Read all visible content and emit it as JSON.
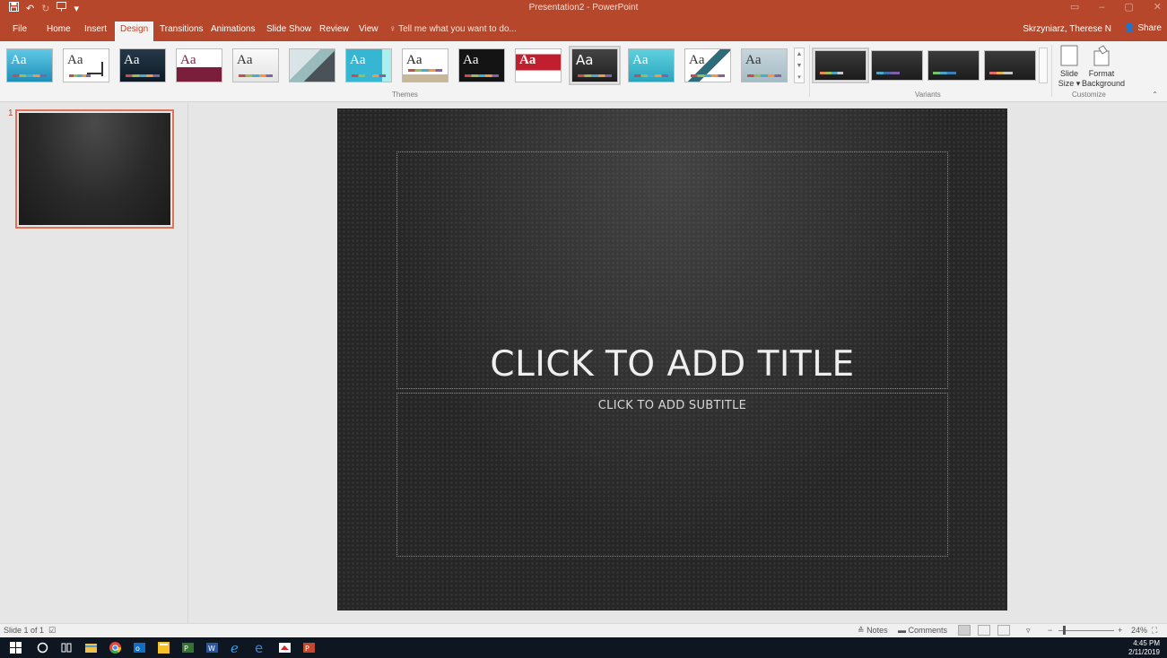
{
  "title_bar": {
    "window_title": "Presentation2 - PowerPoint",
    "qat_icons": [
      "save-icon",
      "undo-icon",
      "redo-icon",
      "start-from-beginning-icon",
      "customize-qat-icon"
    ]
  },
  "tabs": [
    "File",
    "Home",
    "Insert",
    "Design",
    "Transitions",
    "Animations",
    "Slide Show",
    "Review",
    "View"
  ],
  "active_tab": "Design",
  "tell_me": "Tell me what you want to do...",
  "account": {
    "user_name": "Skrzyniarz, Therese N",
    "share_label": "Share"
  },
  "ribbon": {
    "themes_label": "Themes",
    "variants_label": "Variants",
    "customize_label": "Customize",
    "themes": [
      {
        "text": "Aa"
      },
      {
        "text": "Aa"
      },
      {
        "text": "Aa"
      },
      {
        "text": "Aa"
      },
      {
        "text": "Aa"
      },
      {
        "text": ""
      },
      {
        "text": "Aa"
      },
      {
        "text": "Aa"
      },
      {
        "text": "Aa"
      },
      {
        "text": "Aa"
      },
      {
        "text": "Aa"
      },
      {
        "text": "Aa"
      },
      {
        "text": "Aa"
      },
      {
        "text": "Aa"
      }
    ],
    "slide_size": {
      "line1": "Slide",
      "line2": "Size ▾"
    },
    "format_background": {
      "line1": "Format",
      "line2": "Background"
    }
  },
  "thumbnails": {
    "slide_number": "1"
  },
  "slide": {
    "title_placeholder": "CLICK TO ADD TITLE",
    "subtitle_placeholder": "CLICK TO ADD SUBTITLE"
  },
  "status_bar": {
    "slide_info": "Slide 1 of 1",
    "notes": "Notes",
    "comments": "Comments",
    "zoom_minus": "−",
    "zoom_plus": "+",
    "zoom_level": "24%"
  },
  "taskbar": {
    "time": "4:45 PM",
    "date": "2/11/2019"
  },
  "colors": {
    "accent": "#b7472a",
    "slide_bg": "#262626",
    "taskbar": "#0e1621"
  }
}
